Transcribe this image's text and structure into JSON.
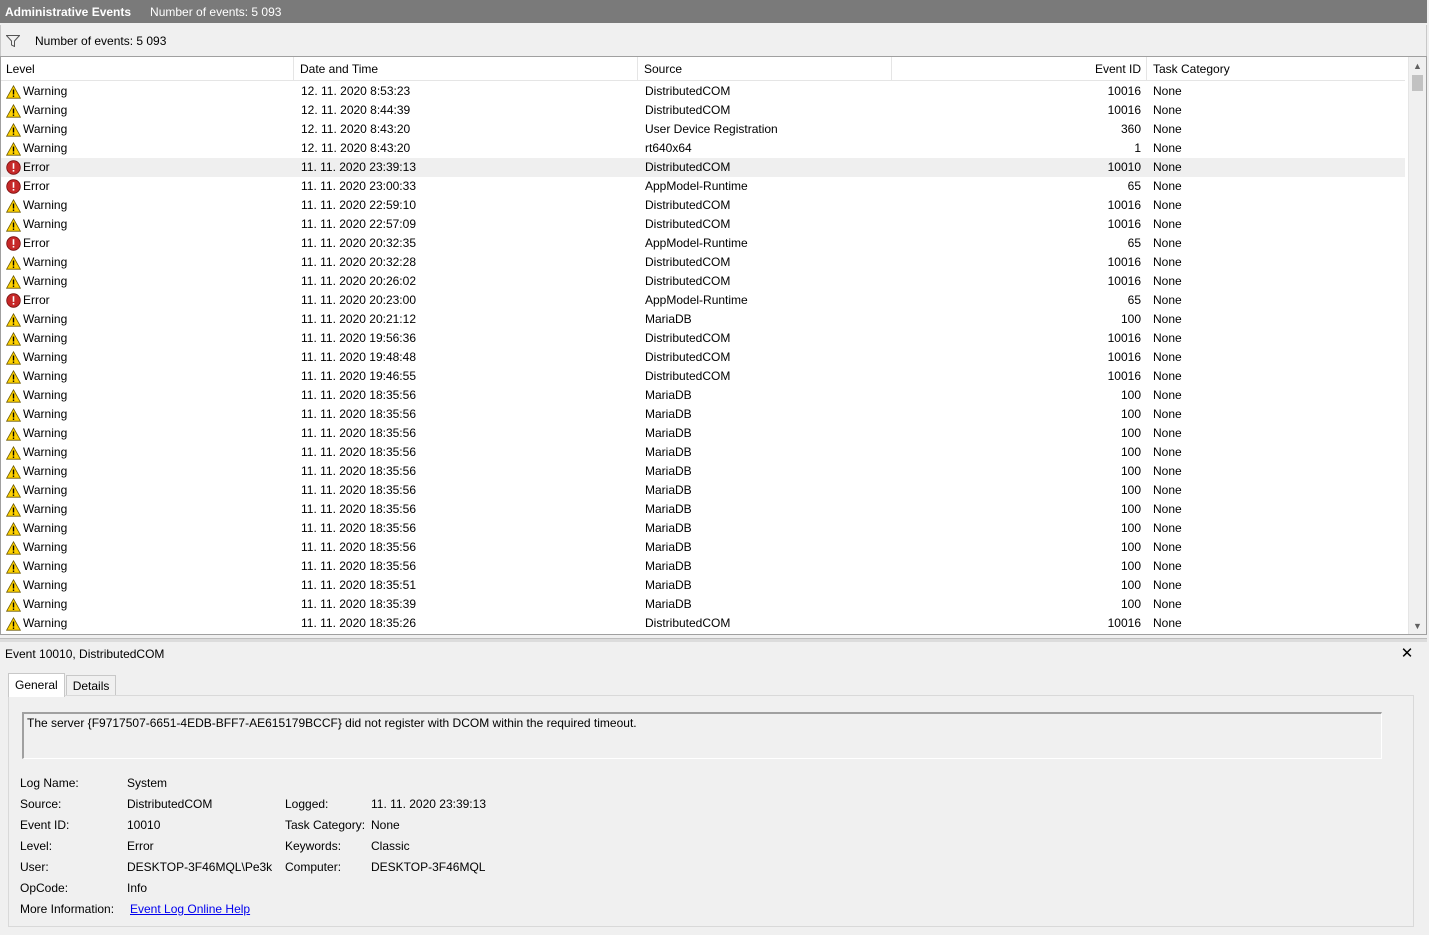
{
  "titlebar": {
    "title": "Administrative Events",
    "count": "Number of events: 5 093"
  },
  "filterbar": {
    "icon": "filter-icon",
    "count": "Number of events: 5 093"
  },
  "columns": {
    "level": "Level",
    "date": "Date and Time",
    "source": "Source",
    "event_id": "Event ID",
    "task": "Task Category"
  },
  "colors": {
    "warning": "#ffd200",
    "error": "#c62828",
    "titlebar": "#7a7a7a",
    "link": "#0000ee"
  },
  "rows": [
    {
      "level": "Warning",
      "date": "12. 11. 2020 8:53:23",
      "source": "DistributedCOM",
      "id": "10016",
      "task": "None"
    },
    {
      "level": "Warning",
      "date": "12. 11. 2020 8:44:39",
      "source": "DistributedCOM",
      "id": "10016",
      "task": "None"
    },
    {
      "level": "Warning",
      "date": "12. 11. 2020 8:43:20",
      "source": "User Device Registration",
      "id": "360",
      "task": "None"
    },
    {
      "level": "Warning",
      "date": "12. 11. 2020 8:43:20",
      "source": "rt640x64",
      "id": "1",
      "task": "None"
    },
    {
      "level": "Error",
      "date": "11. 11. 2020 23:39:13",
      "source": "DistributedCOM",
      "id": "10010",
      "task": "None",
      "selected": true
    },
    {
      "level": "Error",
      "date": "11. 11. 2020 23:00:33",
      "source": "AppModel-Runtime",
      "id": "65",
      "task": "None"
    },
    {
      "level": "Warning",
      "date": "11. 11. 2020 22:59:10",
      "source": "DistributedCOM",
      "id": "10016",
      "task": "None"
    },
    {
      "level": "Warning",
      "date": "11. 11. 2020 22:57:09",
      "source": "DistributedCOM",
      "id": "10016",
      "task": "None"
    },
    {
      "level": "Error",
      "date": "11. 11. 2020 20:32:35",
      "source": "AppModel-Runtime",
      "id": "65",
      "task": "None"
    },
    {
      "level": "Warning",
      "date": "11. 11. 2020 20:32:28",
      "source": "DistributedCOM",
      "id": "10016",
      "task": "None"
    },
    {
      "level": "Warning",
      "date": "11. 11. 2020 20:26:02",
      "source": "DistributedCOM",
      "id": "10016",
      "task": "None"
    },
    {
      "level": "Error",
      "date": "11. 11. 2020 20:23:00",
      "source": "AppModel-Runtime",
      "id": "65",
      "task": "None"
    },
    {
      "level": "Warning",
      "date": "11. 11. 2020 20:21:12",
      "source": "MariaDB",
      "id": "100",
      "task": "None"
    },
    {
      "level": "Warning",
      "date": "11. 11. 2020 19:56:36",
      "source": "DistributedCOM",
      "id": "10016",
      "task": "None"
    },
    {
      "level": "Warning",
      "date": "11. 11. 2020 19:48:48",
      "source": "DistributedCOM",
      "id": "10016",
      "task": "None"
    },
    {
      "level": "Warning",
      "date": "11. 11. 2020 19:46:55",
      "source": "DistributedCOM",
      "id": "10016",
      "task": "None"
    },
    {
      "level": "Warning",
      "date": "11. 11. 2020 18:35:56",
      "source": "MariaDB",
      "id": "100",
      "task": "None"
    },
    {
      "level": "Warning",
      "date": "11. 11. 2020 18:35:56",
      "source": "MariaDB",
      "id": "100",
      "task": "None"
    },
    {
      "level": "Warning",
      "date": "11. 11. 2020 18:35:56",
      "source": "MariaDB",
      "id": "100",
      "task": "None"
    },
    {
      "level": "Warning",
      "date": "11. 11. 2020 18:35:56",
      "source": "MariaDB",
      "id": "100",
      "task": "None"
    },
    {
      "level": "Warning",
      "date": "11. 11. 2020 18:35:56",
      "source": "MariaDB",
      "id": "100",
      "task": "None"
    },
    {
      "level": "Warning",
      "date": "11. 11. 2020 18:35:56",
      "source": "MariaDB",
      "id": "100",
      "task": "None"
    },
    {
      "level": "Warning",
      "date": "11. 11. 2020 18:35:56",
      "source": "MariaDB",
      "id": "100",
      "task": "None"
    },
    {
      "level": "Warning",
      "date": "11. 11. 2020 18:35:56",
      "source": "MariaDB",
      "id": "100",
      "task": "None"
    },
    {
      "level": "Warning",
      "date": "11. 11. 2020 18:35:56",
      "source": "MariaDB",
      "id": "100",
      "task": "None"
    },
    {
      "level": "Warning",
      "date": "11. 11. 2020 18:35:56",
      "source": "MariaDB",
      "id": "100",
      "task": "None"
    },
    {
      "level": "Warning",
      "date": "11. 11. 2020 18:35:51",
      "source": "MariaDB",
      "id": "100",
      "task": "None"
    },
    {
      "level": "Warning",
      "date": "11. 11. 2020 18:35:39",
      "source": "MariaDB",
      "id": "100",
      "task": "None"
    },
    {
      "level": "Warning",
      "date": "11. 11. 2020 18:35:26",
      "source": "DistributedCOM",
      "id": "10016",
      "task": "None"
    }
  ],
  "detail": {
    "header": "Event 10010, DistributedCOM",
    "close": "✕",
    "tabs": {
      "general": "General",
      "details": "Details"
    },
    "description": "The server {F9717507-6651-4EDB-BFF7-AE615179BCCF} did not register with DCOM within the required timeout.",
    "labels": {
      "log_name": "Log Name:",
      "source": "Source:",
      "event_id": "Event ID:",
      "level": "Level:",
      "user": "User:",
      "opcode": "OpCode:",
      "more_info": "More Information:",
      "logged": "Logged:",
      "task_category": "Task Category:",
      "keywords": "Keywords:",
      "computer": "Computer:"
    },
    "values": {
      "log_name": "System",
      "source": "DistributedCOM",
      "event_id": "10010",
      "level": "Error",
      "user": "DESKTOP-3F46MQL\\Pe3k",
      "opcode": "Info",
      "more_info": "Event Log Online Help",
      "logged": "11. 11. 2020 23:39:13",
      "task_category": "None",
      "keywords": "Classic",
      "computer": "DESKTOP-3F46MQL"
    }
  }
}
